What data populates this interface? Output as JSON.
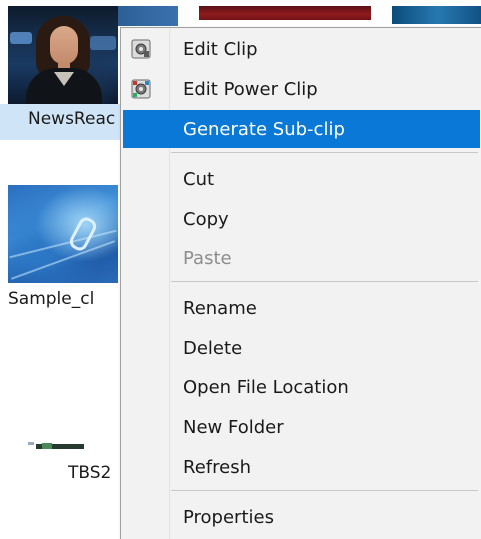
{
  "media_browser": {
    "items": [
      {
        "label": "NewsReac",
        "selected": true
      },
      {
        "label": "Sample_cl",
        "selected": false
      },
      {
        "label": "TBS2",
        "selected": false
      }
    ]
  },
  "context_menu": {
    "items": [
      {
        "label": "Edit Clip",
        "icon": "edit-clip-icon",
        "state": "normal"
      },
      {
        "label": "Edit Power Clip",
        "icon": "edit-power-clip-icon",
        "state": "normal"
      },
      {
        "label": "Generate Sub-clip",
        "state": "highlighted"
      },
      {
        "label": "Cut",
        "state": "normal"
      },
      {
        "label": "Copy",
        "state": "normal"
      },
      {
        "label": "Paste",
        "state": "disabled"
      },
      {
        "label": "Rename",
        "state": "normal"
      },
      {
        "label": "Delete",
        "state": "normal"
      },
      {
        "label": "Open File Location",
        "state": "normal"
      },
      {
        "label": "New Folder",
        "state": "normal"
      },
      {
        "label": "Refresh",
        "state": "normal"
      },
      {
        "label": "Properties",
        "state": "normal"
      }
    ]
  },
  "colors": {
    "highlight": "#0a78d7",
    "menu_background": "#f2f2f2",
    "disabled_text": "#8d8d8d",
    "selection_band": "#cfe5f7"
  }
}
